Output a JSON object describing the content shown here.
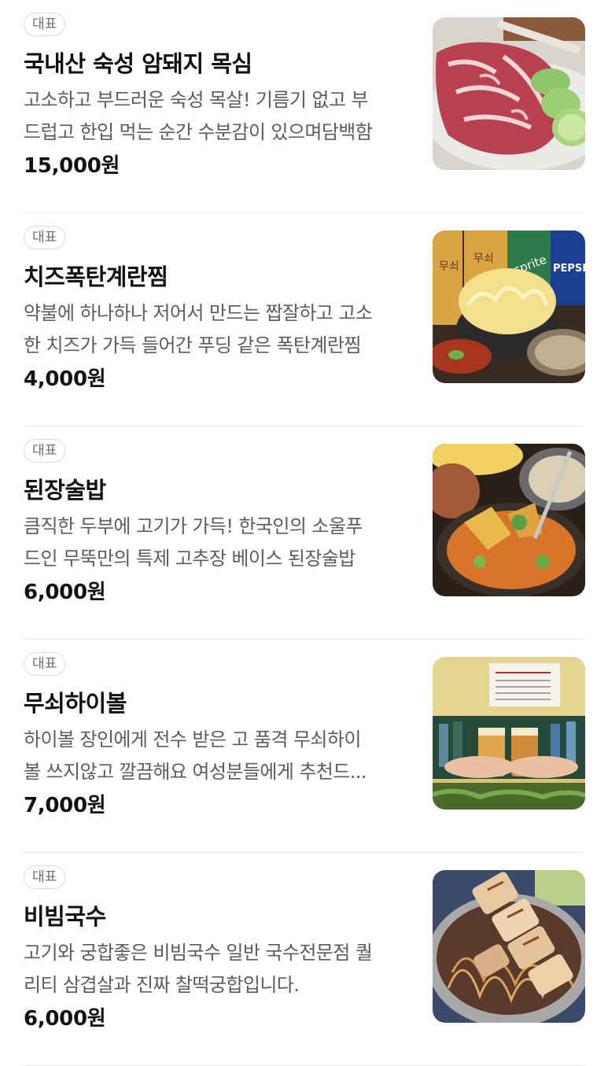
{
  "menu": {
    "items": [
      {
        "badge": "대표",
        "name": "국내산 숙성 암돼지 목심",
        "desc_line1": "고소하고 부드러운 숙성 목살! 기름기 없고 부",
        "desc_line2": "드럽고 한입 먹는 순간 수분감이 있으며담백함",
        "price": "15,000원",
        "image_icon": "pork-neck-photo"
      },
      {
        "badge": "대표",
        "name": "치즈폭탄계란찜",
        "desc_line1": "약불에 하나하나 저어서 만드는 짭잘하고 고소",
        "desc_line2": "한 치즈가 가득 들어간 푸딩 같은 폭탄계란찜",
        "price": "4,000원",
        "image_icon": "cheese-egg-photo",
        "image_labels": {
          "bottle_text": "무쇠",
          "can1": "sprite",
          "can2": "PEPSI"
        }
      },
      {
        "badge": "대표",
        "name": "된장술밥",
        "desc_line1": "큼직한 두부에 고기가 가득! 한국인의 소울푸",
        "desc_line2": "드인 무뚝만의 특제 고추장 베이스 된장술밥",
        "price": "6,000원",
        "image_icon": "doenjang-stew-photo"
      },
      {
        "badge": "대표",
        "name": "무쇠하이볼",
        "desc_line1": "하이볼 장인에게 전수 받은 고 품격 무쇠하이",
        "desc_line2": "볼 쓰지않고 깔끔해요 여성분들에게 추천드...",
        "price": "7,000원",
        "image_icon": "highball-photo"
      },
      {
        "badge": "대표",
        "name": "비빔국수",
        "desc_line1": "고기와 궁합좋은 비빔국수 일반 국수전문점 퀄",
        "desc_line2": "리티 삼겹살과 진짜 찰떡궁합입니다.",
        "price": "6,000원",
        "image_icon": "bibim-noodle-photo"
      }
    ]
  }
}
